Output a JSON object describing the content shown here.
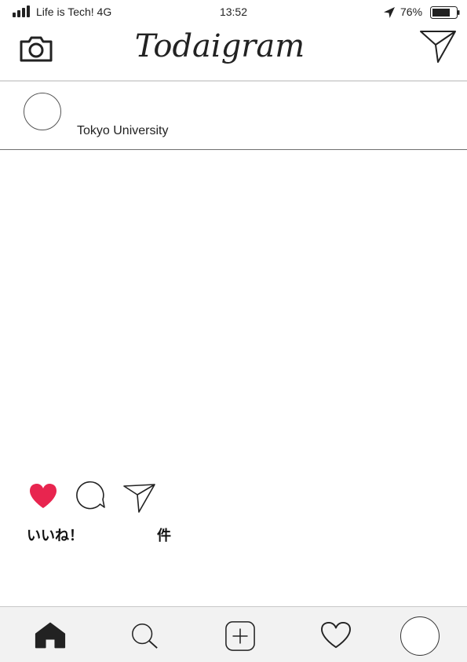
{
  "status_bar": {
    "carrier": "Life is Tech!  4G",
    "time": "13:52",
    "battery": "76%",
    "battery_level": 0.76
  },
  "header": {
    "logo": "Todaigram",
    "left_icon": "camera-icon",
    "right_icon": "direct-message-icon"
  },
  "post": {
    "username": "Tokyo University",
    "likes_label": "いいね！",
    "likes_count": "",
    "likes_unit": "件",
    "liked": true,
    "accent_color": "#e8254f"
  },
  "tab_bar": {
    "items": [
      "home-icon",
      "search-icon",
      "add-post-icon",
      "activity-heart-icon",
      "profile-avatar"
    ],
    "background": "#f2f2f2"
  }
}
